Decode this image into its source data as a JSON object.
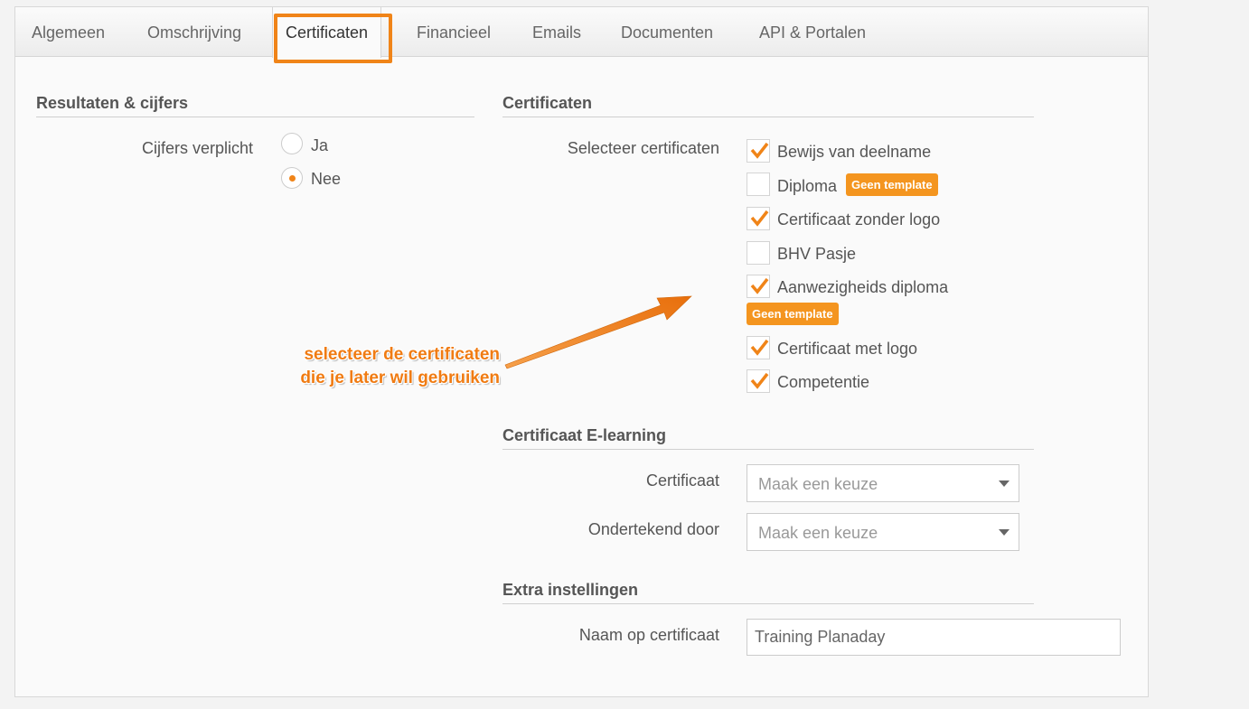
{
  "tabs": [
    {
      "label": "Algemeen",
      "active": false
    },
    {
      "label": "Omschrijving",
      "active": false
    },
    {
      "label": "Certificaten",
      "active": true
    },
    {
      "label": "Financieel",
      "active": false
    },
    {
      "label": "Emails",
      "active": false
    },
    {
      "label": "Documenten",
      "active": false
    },
    {
      "label": "API & Portalen",
      "active": false
    }
  ],
  "results": {
    "title": "Resultaten & cijfers",
    "label": "Cijfers verplicht",
    "options": [
      {
        "label": "Ja",
        "selected": false
      },
      {
        "label": "Nee",
        "selected": true
      }
    ]
  },
  "certificates": {
    "title": "Certificaten",
    "label": "Selecteer certificaten",
    "items": [
      {
        "label": "Bewijs van deelname",
        "checked": true
      },
      {
        "label": "Diploma",
        "checked": false,
        "badge": "Geen template"
      },
      {
        "label": "Certificaat zonder logo",
        "checked": true
      },
      {
        "label": "BHV Pasje",
        "checked": false
      },
      {
        "label": "Aanwezigheids diploma",
        "checked": true,
        "badge": "Geen template"
      },
      {
        "label": "Certificaat met logo",
        "checked": true
      },
      {
        "label": "Competentie",
        "checked": true
      }
    ]
  },
  "elearning": {
    "title": "Certificaat E-learning",
    "certificate_label": "Certificaat",
    "certificate_value": "Maak een keuze",
    "signed_label": "Ondertekend door",
    "signed_value": "Maak een keuze"
  },
  "extra": {
    "title": "Extra instellingen",
    "name_label": "Naam op certificaat",
    "name_value": "Training Planaday"
  },
  "annotation": {
    "line1": "selecteer de certificaten",
    "line2": "die je later wil gebruiken"
  },
  "colors": {
    "accent": "#f08418",
    "badge": "#f4951f"
  }
}
